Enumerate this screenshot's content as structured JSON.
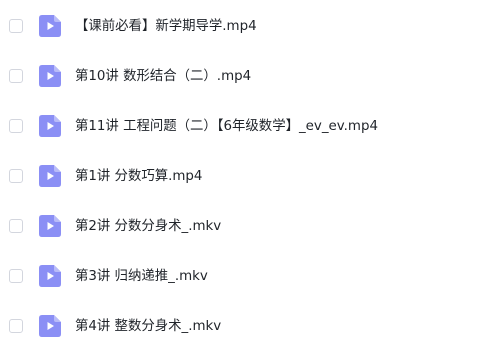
{
  "files": [
    {
      "name": "【课前必看】新学期导学.mp4",
      "icon": "video-file-icon"
    },
    {
      "name": "第10讲 数形结合（二）.mp4",
      "icon": "video-file-icon"
    },
    {
      "name": "第11讲 工程问题（二）【6年级数学】_ev_ev.mp4",
      "icon": "video-file-icon"
    },
    {
      "name": "第1讲 分数巧算.mp4",
      "icon": "video-file-icon"
    },
    {
      "name": "第2讲 分数分身术_.mkv",
      "icon": "video-file-icon"
    },
    {
      "name": "第3讲 归纳递推_.mkv",
      "icon": "video-file-icon"
    },
    {
      "name": "第4讲 整数分身术_.mkv",
      "icon": "video-file-icon"
    }
  ],
  "colors": {
    "icon_bg": "#8b8ff5",
    "icon_play": "#ffffff",
    "checkbox_border": "#d3d6de",
    "text": "#1f2329"
  }
}
